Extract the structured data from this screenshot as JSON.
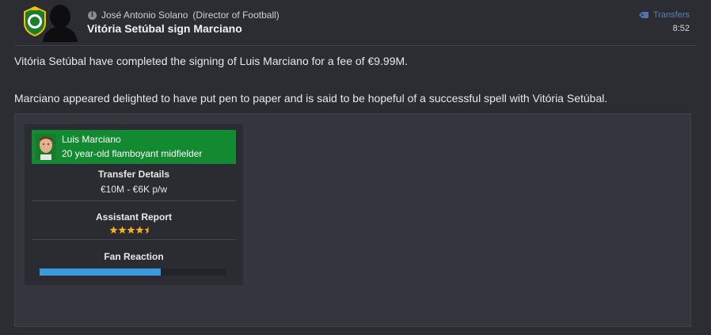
{
  "message": {
    "sender_name": "José Antonio Solano",
    "sender_role": "(Director of Football)",
    "headline": "Vitória Setúbal sign Marciano",
    "category": "Transfers",
    "time": "8:52",
    "paragraphs": [
      "Vitória Setúbal have completed the signing of Luis Marciano for a fee of €9.99M.",
      "Marciano appeared delighted to have put pen to paper and is said to be hopeful of a successful spell with Vitória Setúbal."
    ]
  },
  "card": {
    "player_name": "Luis Marciano",
    "player_desc": "20 year-old flamboyant midfielder",
    "transfer_title": "Transfer Details",
    "transfer_value": "€10M - €6K p/w",
    "report_title": "Assistant Report",
    "report_stars": 4.5,
    "report_stars_max": 5,
    "fan_title": "Fan Reaction",
    "fan_reaction_fraction": 0.65
  },
  "colors": {
    "background": "#2b2d33",
    "player_header": "#138a32",
    "star": "#f2b01e",
    "fan_bar": "#3a9ae0",
    "link": "#5d7fb3"
  },
  "icons": {
    "info": "info-icon",
    "category": "tag-icon",
    "crest": "club-crest-icon",
    "sender": "person-silhouette-icon",
    "player": "player-face-icon"
  }
}
